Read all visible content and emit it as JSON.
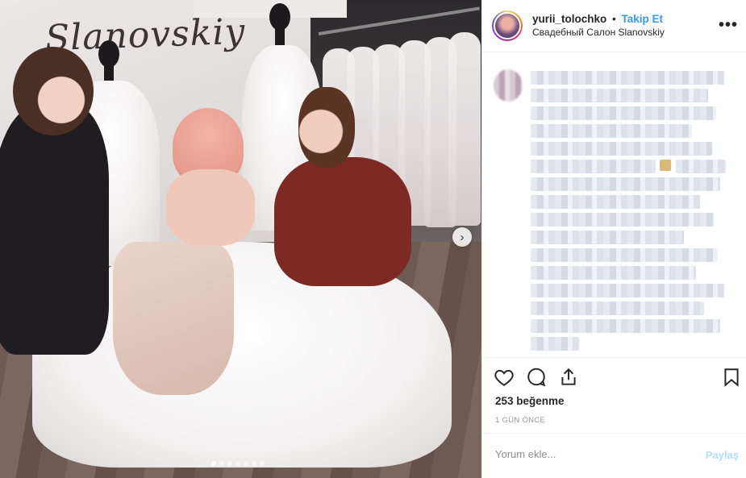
{
  "photo": {
    "logo_text": "Slanovskiy",
    "carousel_total": 7,
    "carousel_index": 1,
    "next_icon": "chevron-right-icon",
    "next_glyph": "›"
  },
  "post_header": {
    "username": "yurii_tolochko",
    "separator": "•",
    "follow_label": "Takip Et",
    "location": "Свадебный Салон Slanovskiy",
    "more_glyph": "•••"
  },
  "actions": {
    "like_icon": "heart-icon",
    "comment_icon": "comment-icon",
    "share_icon": "share-icon",
    "save_icon": "bookmark-icon"
  },
  "stats": {
    "likes": "253 beğenme",
    "time": "1 GÜN ÖNCE"
  },
  "comment_box": {
    "placeholder": "Yorum ekle...",
    "submit_label": "Paylaş"
  },
  "colors": {
    "link": "#3897f0",
    "submit_disabled": "#b2dffc",
    "border": "#efefef"
  }
}
